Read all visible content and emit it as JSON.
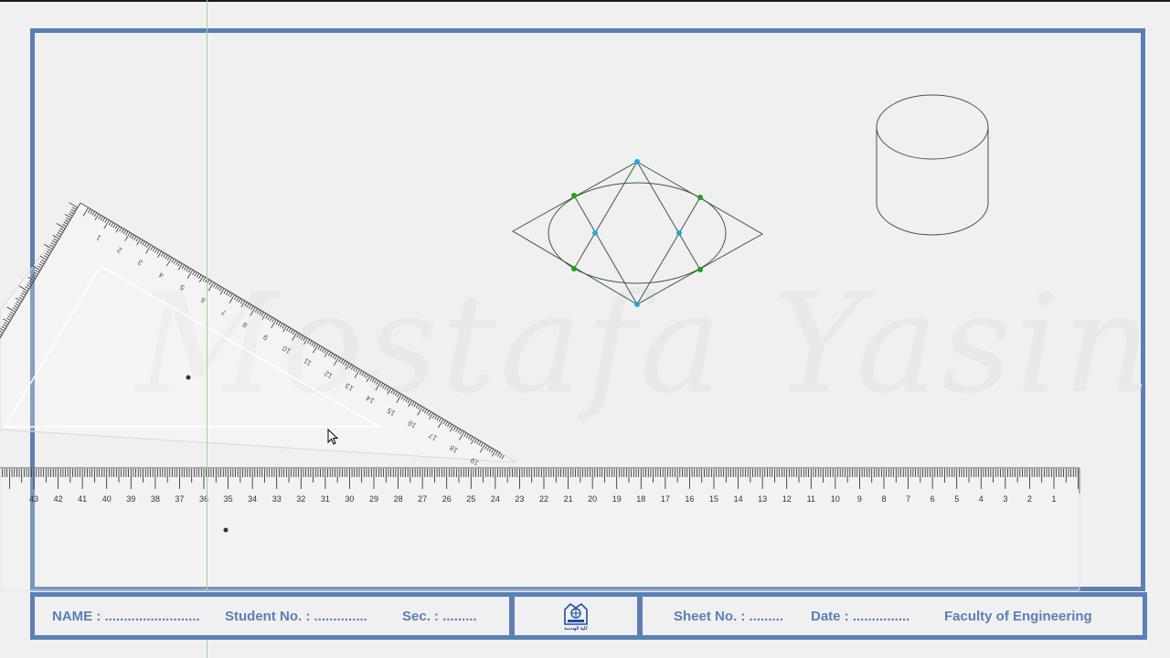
{
  "title_block": {
    "name_label": "NAME : .........................",
    "student_no_label": "Student No. : ..............",
    "sec_label": "Sec. : .........",
    "sheet_no_label": "Sheet No. : .........",
    "date_label": "Date : ...............",
    "faculty_label": "Faculty of Engineering",
    "logo_caption": "كلية الهندسة"
  },
  "watermark_text": "Mostafa Yasin",
  "ruler": {
    "numbers": [
      "43",
      "42",
      "41",
      "40",
      "39",
      "38",
      "37",
      "36",
      "35",
      "34",
      "33",
      "32",
      "31",
      "30",
      "29",
      "28",
      "27",
      "26",
      "25",
      "24",
      "23",
      "22",
      "21",
      "20",
      "19",
      "18",
      "17",
      "16",
      "15",
      "14",
      "13",
      "12",
      "11",
      "10",
      "9",
      "8",
      "7",
      "6",
      "5",
      "4",
      "3",
      "2",
      "1"
    ]
  },
  "set_square": {
    "numbers": [
      "1",
      "2",
      "3",
      "4",
      "5",
      "6",
      "7",
      "8",
      "9",
      "10",
      "11",
      "12",
      "13",
      "14",
      "15",
      "16",
      "17",
      "18",
      "19"
    ]
  },
  "colors": {
    "frame": "#5b7fb5",
    "drawing_line": "#3d5a3d",
    "tangent_point": "#22a022",
    "construction_point": "#2aa7d8",
    "guide_line": "#9bd49b"
  }
}
